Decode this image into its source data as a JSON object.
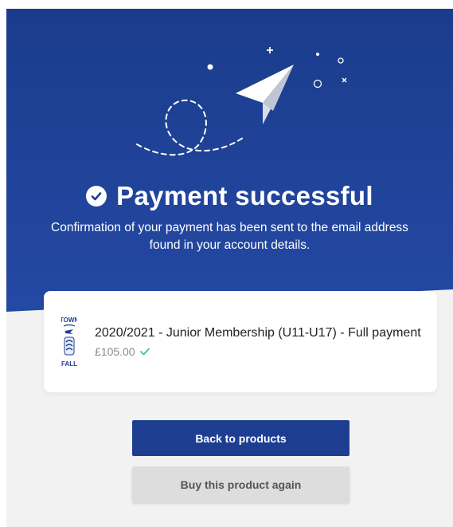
{
  "hero": {
    "title": "Payment successful",
    "message": "Confirmation of your payment has been sent to the email address found in your account details.",
    "icons": [
      "paper-plane-icon",
      "check-circle-icon"
    ]
  },
  "order": {
    "product_name": "2020/2021 - Junior Membership (U11-U17) - Full payment",
    "price": "£105.00",
    "status_icon": "checkmark-icon",
    "logo_name": "club-crest-logo",
    "logo_text": "TOWN FALL"
  },
  "actions": {
    "back_label": "Back to products",
    "again_label": "Buy this product again"
  },
  "colors": {
    "brand_blue": "#1e3f91",
    "success_green": "#2ecc8f",
    "background": "#f2f2f2"
  }
}
